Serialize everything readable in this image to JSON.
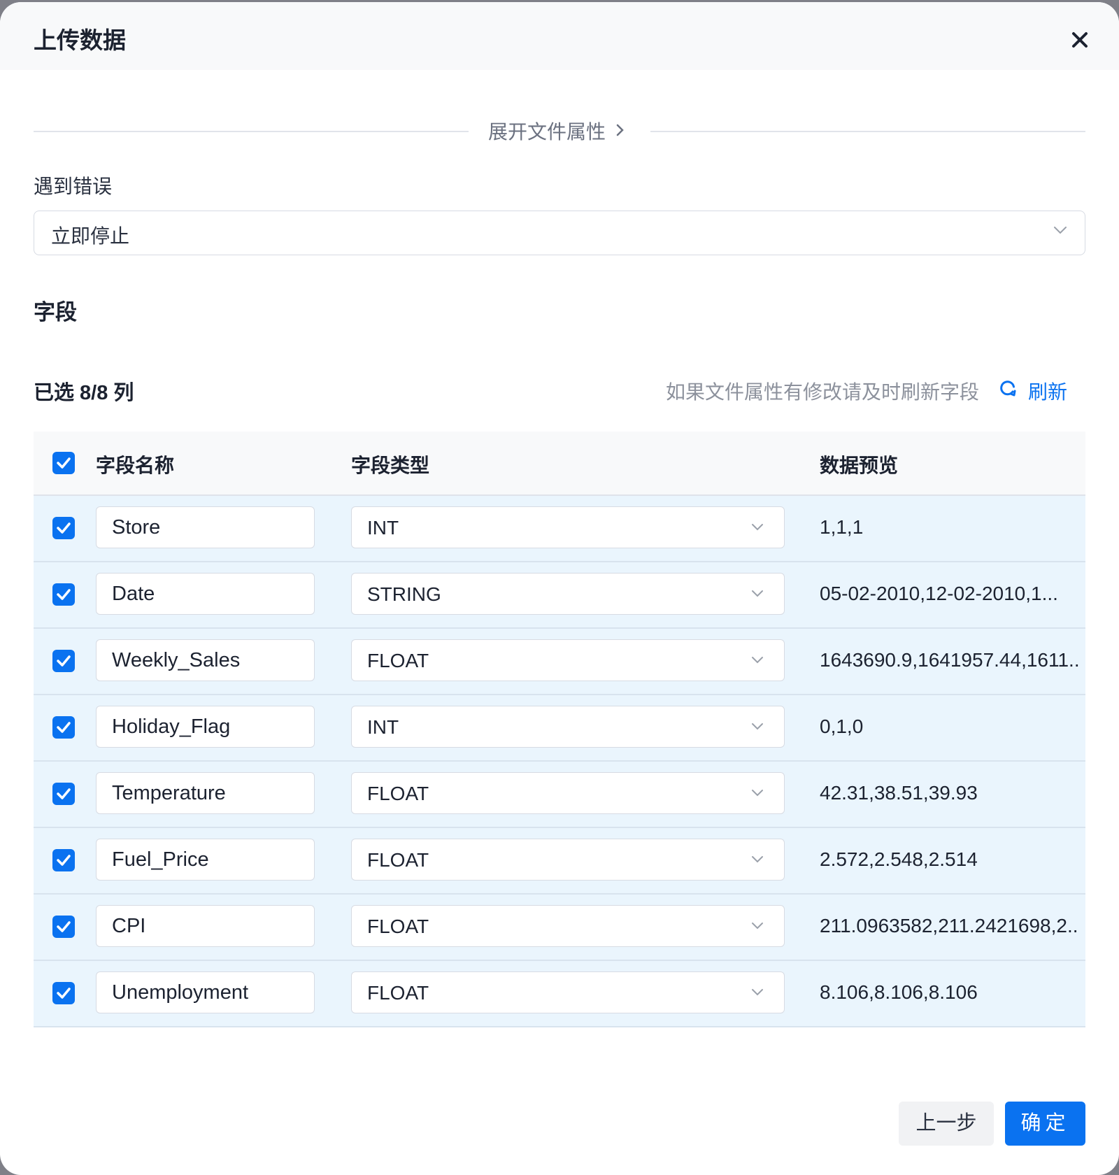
{
  "dialog": {
    "title": "上传数据",
    "expand_label": "展开文件属性",
    "error_label": "遇到错误",
    "error_value": "立即停止",
    "fields_title": "字段",
    "selected_count": "已选 8/8 列",
    "refresh_hint": "如果文件属性有修改请及时刷新字段",
    "refresh_label": "刷新"
  },
  "table": {
    "headers": {
      "name": "字段名称",
      "type": "字段类型",
      "preview": "数据预览"
    },
    "rows": [
      {
        "checked": true,
        "name": "Store",
        "type": "INT",
        "preview": "1,1,1"
      },
      {
        "checked": true,
        "name": "Date",
        "type": "STRING",
        "preview": "05-02-2010,12-02-2010,1..."
      },
      {
        "checked": true,
        "name": "Weekly_Sales",
        "type": "FLOAT",
        "preview": "1643690.9,1641957.44,1611..."
      },
      {
        "checked": true,
        "name": "Holiday_Flag",
        "type": "INT",
        "preview": "0,1,0"
      },
      {
        "checked": true,
        "name": "Temperature",
        "type": "FLOAT",
        "preview": "42.31,38.51,39.93"
      },
      {
        "checked": true,
        "name": "Fuel_Price",
        "type": "FLOAT",
        "preview": "2.572,2.548,2.514"
      },
      {
        "checked": true,
        "name": "CPI",
        "type": "FLOAT",
        "preview": "211.0963582,211.2421698,2..."
      },
      {
        "checked": true,
        "name": "Unemployment",
        "type": "FLOAT",
        "preview": "8.106,8.106,8.106"
      }
    ]
  },
  "footer": {
    "prev_label": "上一步",
    "confirm_label": "确定"
  },
  "colors": {
    "accent": "#0a72f0",
    "row_bg": "#eaf5fd",
    "header_bg": "#f8f9fa"
  }
}
